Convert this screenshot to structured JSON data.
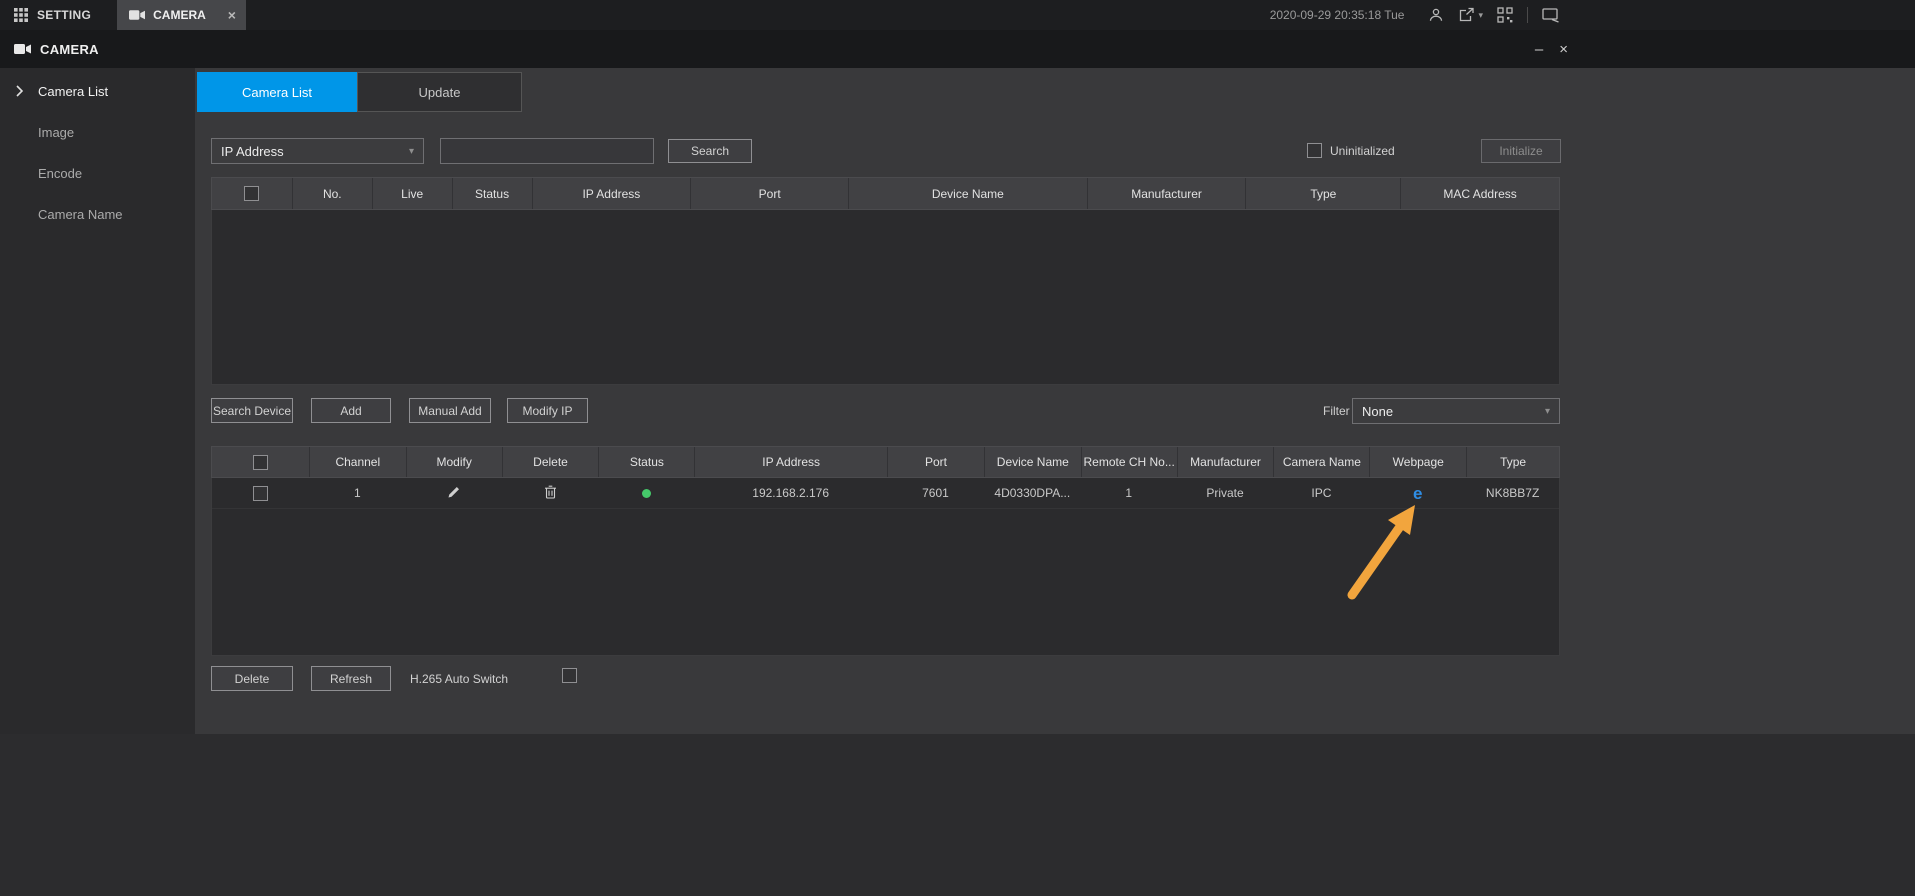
{
  "colors": {
    "accent": "#0096e8",
    "status_ok": "#45c96a",
    "annotation_arrow": "#f2a53d"
  },
  "topbar": {
    "setting_tab": "SETTING",
    "camera_tab": "CAMERA",
    "datetime": "2020-09-29 20:35:18 Tue"
  },
  "window": {
    "title": "CAMERA"
  },
  "sidebar": {
    "items": [
      {
        "label": "Camera List"
      },
      {
        "label": "Image"
      },
      {
        "label": "Encode"
      },
      {
        "label": "Camera Name"
      }
    ]
  },
  "tabs": {
    "camera_list": "Camera List",
    "update": "Update"
  },
  "toolbar": {
    "search_type": "IP Address",
    "search_value": "",
    "search_button": "Search",
    "uninitialized": "Uninitialized",
    "initialize": "Initialize"
  },
  "device_table": {
    "headers": [
      "No.",
      "Live",
      "Status",
      "IP Address",
      "Port",
      "Device Name",
      "Manufacturer",
      "Type",
      "MAC Address"
    ]
  },
  "actions": {
    "search_device": "Search Device",
    "add": "Add",
    "manual_add": "Manual Add",
    "modify_ip": "Modify IP",
    "filter_label": "Filter",
    "filter_value": "None"
  },
  "camera_table": {
    "headers": [
      "Channel",
      "Modify",
      "Delete",
      "Status",
      "IP Address",
      "Port",
      "Device Name",
      "Remote CH No...",
      "Manufacturer",
      "Camera Name",
      "Webpage",
      "Type"
    ],
    "row": {
      "channel": "1",
      "ip_address": "192.168.2.176",
      "port": "7601",
      "device_name": "4D0330DPA...",
      "remote_ch_no": "1",
      "manufacturer": "Private",
      "camera_name": "IPC",
      "webpage_icon": "e",
      "type": "NK8BB7Z"
    }
  },
  "footer": {
    "delete": "Delete",
    "refresh": "Refresh",
    "h265_label": "H.265 Auto Switch"
  }
}
